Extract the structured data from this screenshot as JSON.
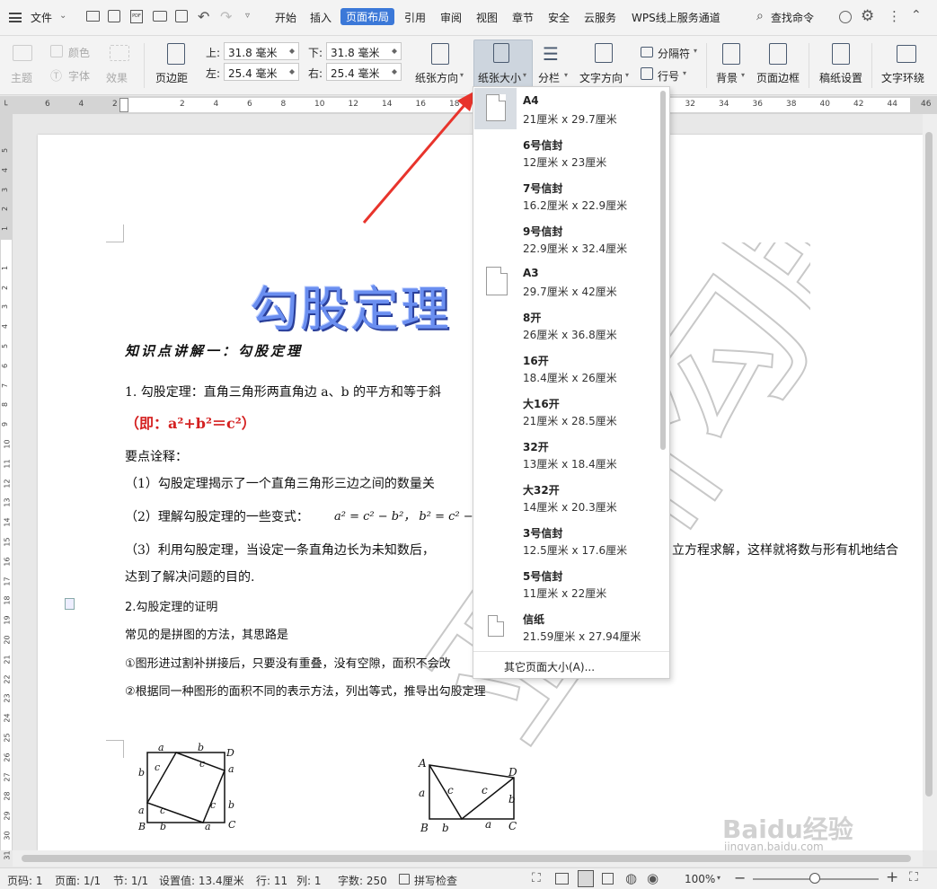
{
  "menubar": {
    "file": "文件",
    "tabs": [
      "开始",
      "插入",
      "页面布局",
      "引用",
      "审阅",
      "视图",
      "章节",
      "安全",
      "云服务",
      "WPS线上服务通道"
    ],
    "search": "查找命令"
  },
  "ribbon": {
    "theme": "主题",
    "color": "颜色",
    "font": "字体",
    "effect": "效果",
    "margins": "页边距",
    "top_label": "上:",
    "top_value": "31.8 毫米",
    "bottom_label": "下:",
    "bottom_value": "31.8 毫米",
    "left_label": "左:",
    "left_value": "25.4 毫米",
    "right_label": "右:",
    "right_value": "25.4 毫米",
    "orientation": "纸张方向",
    "size": "纸张大小",
    "columns": "分栏",
    "text_direction": "文字方向",
    "breaks": "分隔符",
    "line_numbers": "行号",
    "background": "背景",
    "page_border": "页面边框",
    "manuscript": "稿纸设置",
    "text_wrap": "文字环绕"
  },
  "ruler": {
    "h": [
      "6",
      "4",
      "2",
      "",
      "2",
      "4",
      "6",
      "8",
      "10",
      "12",
      "14",
      "16",
      "18",
      "20",
      "22",
      "24",
      "26",
      "28",
      "30",
      "32",
      "34",
      "36",
      "38",
      "40",
      "42",
      "44",
      "46",
      "48"
    ],
    "v": [
      "5",
      "4",
      "3",
      "2",
      "1",
      "",
      "1",
      "2",
      "3",
      "4",
      "5",
      "6",
      "7",
      "8",
      "9",
      "10",
      "11",
      "12",
      "13",
      "14",
      "15",
      "16",
      "17",
      "18",
      "19",
      "20",
      "21",
      "22",
      "23",
      "24",
      "25",
      "26",
      "27",
      "28",
      "29",
      "30",
      "31"
    ]
  },
  "document": {
    "title": "勾股定理",
    "section_heading": "知识点讲解一：勾股定理",
    "p1": "1. 勾股定理：直角三角形两直角边 a、b 的平方和等于斜",
    "p1_formula": "（即：a²+b²＝c²）",
    "p2": "要点诠释：",
    "p3": "（1）勾股定理揭示了一个直角三角形三边之间的数量关",
    "p4": "（2）理解勾股定理的一些变式：",
    "p4_formula": "a² = c² − b²， b² = c² − a",
    "p5a": "（3）利用勾股定理，当设定一条直角边长为未知数后，",
    "p5b": "立方程求解，这样就将数与形有机地结合",
    "p6": "达到了解决问题的目的.",
    "p7": "2.勾股定理的证明",
    "p8": "常见的是拼图的方法，其思路是",
    "p9": "①图形进过割补拼接后，只要没有重叠，没有空隙，面积不会改",
    "p10": "②根据同一种图形的面积不同的表示方法，列出等式，推导出勾股定理",
    "watermark": "亚洲勾股",
    "fig1_labels": [
      "a",
      "b",
      "D",
      "b",
      "c",
      "c",
      "a",
      "a",
      "c",
      "c",
      "b",
      "B",
      "b",
      "a",
      "C"
    ],
    "fig2_labels": [
      "A",
      "D",
      "a",
      "c",
      "c",
      "b",
      "B",
      "b",
      "a",
      "C"
    ]
  },
  "dropdown": {
    "items": [
      {
        "name": "A4",
        "dims": "21厘米  x  29.7厘米"
      },
      {
        "name": "6号信封",
        "dims": "12厘米  x  23厘米"
      },
      {
        "name": "7号信封",
        "dims": "16.2厘米  x  22.9厘米"
      },
      {
        "name": "9号信封",
        "dims": "22.9厘米  x  32.4厘米"
      },
      {
        "name": "A3",
        "dims": "29.7厘米  x  42厘米"
      },
      {
        "name": "8开",
        "dims": "26厘米  x  36.8厘米"
      },
      {
        "name": "16开",
        "dims": "18.4厘米  x  26厘米"
      },
      {
        "name": "大16开",
        "dims": "21厘米  x  28.5厘米"
      },
      {
        "name": "32开",
        "dims": "13厘米  x  18.4厘米"
      },
      {
        "name": "大32开",
        "dims": "14厘米  x  20.3厘米"
      },
      {
        "name": "3号信封",
        "dims": "12.5厘米  x  17.6厘米"
      },
      {
        "name": "5号信封",
        "dims": "11厘米  x  22厘米"
      },
      {
        "name": "信纸",
        "dims": "21.59厘米  x  27.94厘米"
      }
    ],
    "more": "其它页面大小(A)..."
  },
  "statusbar": {
    "page": "页码: 1",
    "pages": "页面: 1/1",
    "section": "节: 1/1",
    "setting": "设置值: 13.4厘米",
    "row": "行: 11",
    "col": "列: 1",
    "words": "字数: 250",
    "spell": "拼写检查",
    "zoom": "100%"
  },
  "watermark_site": {
    "logo": "Baidu经验",
    "url": "jingyan.baidu.com"
  },
  "colors": {
    "accent": "#3b78d8",
    "title_blue": "#4a6fd8",
    "formula_red": "#d42020",
    "arrow_red": "#e8342c"
  }
}
